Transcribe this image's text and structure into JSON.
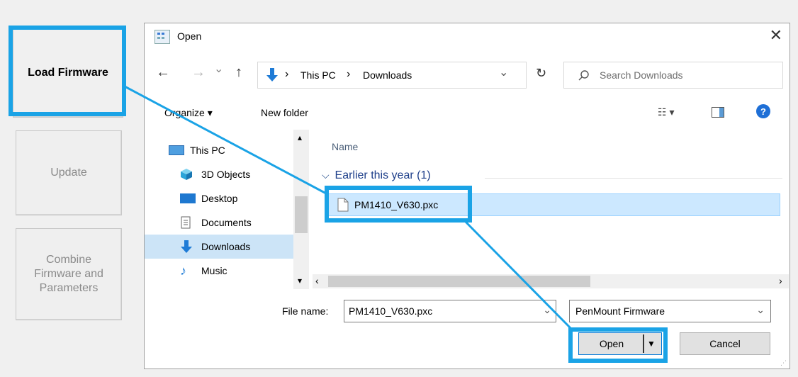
{
  "app_panel": {
    "load_firmware": "Load Firmware",
    "update": "Update",
    "combine": "Combine Firmware and Parameters"
  },
  "dialog": {
    "title": "Open",
    "close_glyph": "✕",
    "nav": {
      "back": "←",
      "forward": "→",
      "recent": "⌄",
      "up": "↑"
    },
    "address": {
      "root": "This PC",
      "sep": "›",
      "folder": "Downloads",
      "dropdown": "⌄",
      "refresh": "↻"
    },
    "search_placeholder": "Search Downloads",
    "toolbar": {
      "organize": "Organize ▾",
      "new_folder": "New folder",
      "view": "☷ ▾",
      "help": "?"
    },
    "tree": [
      {
        "label": "This PC",
        "icon": "computer-icon"
      },
      {
        "label": "3D Objects",
        "icon": "cube-icon"
      },
      {
        "label": "Desktop",
        "icon": "desktop-icon"
      },
      {
        "label": "Documents",
        "icon": "document-icon"
      },
      {
        "label": "Downloads",
        "icon": "download-icon"
      },
      {
        "label": "Music",
        "icon": "music-icon"
      }
    ],
    "file_list": {
      "column_name": "Name",
      "group_label": "Earlier this year (1)",
      "files": [
        {
          "name": "PM1410_V630.pxc",
          "icon": "file-icon"
        }
      ]
    },
    "file_name_label": "File name:",
    "file_name_value": "PM1410_V630.pxc",
    "file_type": "PenMount Firmware",
    "open_button": "Open",
    "cancel_button": "Cancel"
  },
  "colors": {
    "callout": "#1aa3e6",
    "selection": "#cce8ff",
    "accent_blue": "#0078d7"
  }
}
